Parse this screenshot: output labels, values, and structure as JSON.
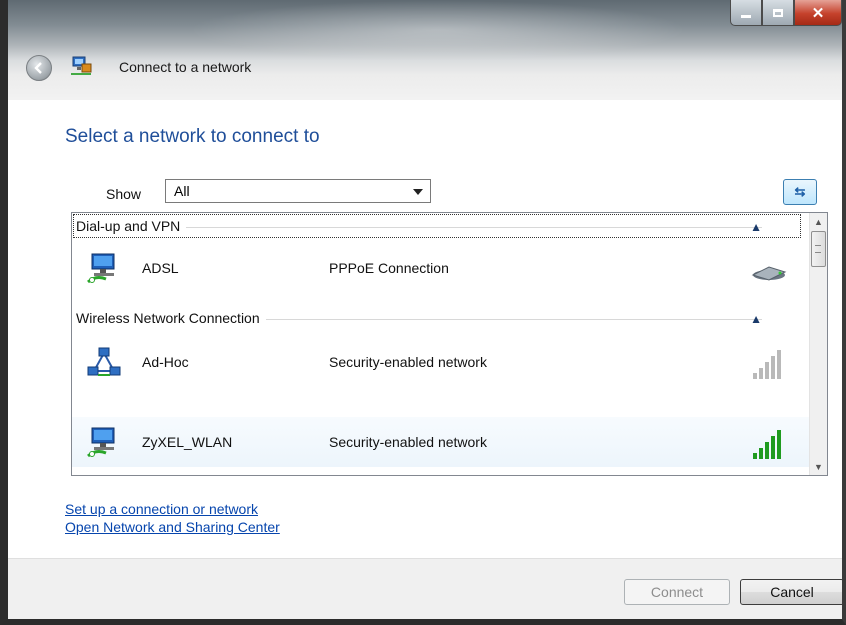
{
  "window": {
    "title": "Connect to a network"
  },
  "main": {
    "heading": "Select a network to connect to",
    "show_label": "Show",
    "show_value": "All"
  },
  "groups": [
    {
      "label": "Dial-up and VPN"
    },
    {
      "label": "Wireless Network Connection"
    }
  ],
  "networks": [
    {
      "name": "ADSL",
      "desc": "PPPoE Connection",
      "icon": "network-computer-icon",
      "status_icon": "modem-icon"
    },
    {
      "name": "Ad-Hoc",
      "desc": "Security-enabled network",
      "icon": "adhoc-network-icon",
      "status_icon": "signal-strength-icon",
      "signal_bars": 0
    },
    {
      "name": "ZyXEL_WLAN",
      "desc": "Security-enabled network",
      "icon": "network-computer-icon",
      "status_icon": "signal-strength-icon",
      "signal_bars": 5
    }
  ],
  "links": {
    "setup": "Set up a connection or network",
    "open_center": "Open Network and Sharing Center"
  },
  "buttons": {
    "connect": "Connect",
    "cancel": "Cancel"
  },
  "colors": {
    "heading": "#1f4e99",
    "link": "#0645ad",
    "signal_on": "#1f9b1f",
    "signal_off": "#b9b9b9"
  }
}
